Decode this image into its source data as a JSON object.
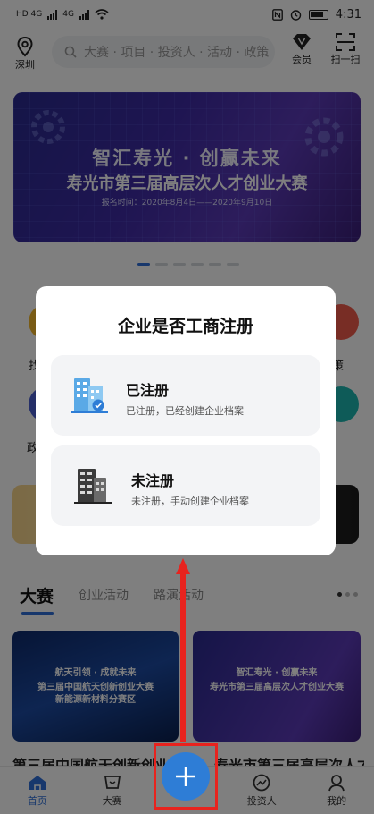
{
  "status_bar": {
    "time": "4:31",
    "left_labels": [
      "HD 4G",
      "4G"
    ]
  },
  "header": {
    "location": "深圳",
    "search_placeholder": "大赛 · 项目 · 投资人 · 活动 · 政策",
    "vip_label": "会员",
    "scan_label": "扫一扫"
  },
  "banner": {
    "line1": "智汇寿光 · 创赢未来",
    "line2": "寿光市第三届高层次人才创业大赛",
    "line3": "报名时间：2020年8月4日——2020年9月10日"
  },
  "background_labels": {
    "left_top": "找",
    "right_top": "策",
    "left_mid": "政"
  },
  "tabs": {
    "items": [
      "大赛",
      "创业活动",
      "路演活动"
    ]
  },
  "cards": [
    {
      "line1": "航天引领 · 成就未来",
      "line2": "第三届中国航天创新创业大赛",
      "line3": "新能源新材料分赛区",
      "title": "第三届中国航天创新创业大"
    },
    {
      "line1": "智汇寿光 · 创赢未来",
      "line2": "寿光市第三届高层次人才创业大赛",
      "line3": "",
      "title": "寿光市第三届高层次人才"
    }
  ],
  "bottom_nav": {
    "items": [
      "首页",
      "大赛",
      "",
      "投资人",
      "我的"
    ]
  },
  "dialog": {
    "title": "企业是否工商注册",
    "options": [
      {
        "title": "已注册",
        "subtitle": "已注册，已经创建企业档案"
      },
      {
        "title": "未注册",
        "subtitle": "未注册，手动创建企业档案"
      }
    ]
  },
  "colors": {
    "accent": "#2e6fd8",
    "highlight": "#e8231e",
    "overlay": "rgba(0,0,0,0.5)"
  }
}
